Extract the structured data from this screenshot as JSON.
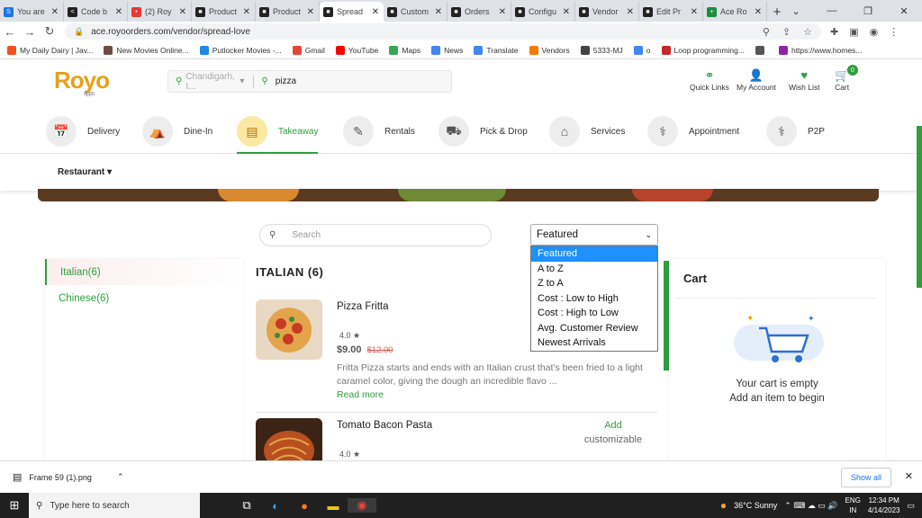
{
  "browser": {
    "tabs": [
      {
        "title": "You are",
        "icon": "S",
        "color": "#1a73e8"
      },
      {
        "title": "Code b",
        "icon": "&lt;",
        "color": "#222"
      },
      {
        "title": "(2) Roy",
        "icon": "•",
        "color": "#e53935"
      },
      {
        "title": "Product",
        "icon": "■",
        "color": "#222"
      },
      {
        "title": "Product",
        "icon": "■",
        "color": "#222"
      },
      {
        "title": "Spread",
        "icon": "■",
        "color": "#222",
        "active": true
      },
      {
        "title": "Custom",
        "icon": "■",
        "color": "#222"
      },
      {
        "title": "Orders",
        "icon": "■",
        "color": "#222"
      },
      {
        "title": "Configu",
        "icon": "■",
        "color": "#222"
      },
      {
        "title": "Vendor",
        "icon": "■",
        "color": "#222"
      },
      {
        "title": "Edit Pr",
        "icon": "■",
        "color": "#222"
      },
      {
        "title": "Ace Ro",
        "icon": "+",
        "color": "#1e8e3e"
      }
    ],
    "url": "ace.royoorders.com/vendor/spread-love",
    "bookmarks": [
      {
        "label": "My Daily Dairy | Jav...",
        "color": "#f4511e"
      },
      {
        "label": "New Movies Online...",
        "color": "#6d4c41"
      },
      {
        "label": "Putlocker Movies -...",
        "color": "#1e88e5"
      },
      {
        "label": "Gmail",
        "color": "#ea4335"
      },
      {
        "label": "YouTube",
        "color": "#ff0000"
      },
      {
        "label": "Maps",
        "color": "#34a853"
      },
      {
        "label": "News",
        "color": "#4285f4"
      },
      {
        "label": "Translate",
        "color": "#4285f4"
      },
      {
        "label": "Vendors",
        "color": "#f57c00"
      },
      {
        "label": "5333-MJ",
        "color": "#444"
      },
      {
        "label": "o",
        "color": "#4285f4"
      },
      {
        "label": "Loop programming...",
        "color": "#c62828"
      },
      {
        "label": "",
        "color": "#555"
      },
      {
        "label": "https://www.homes...",
        "color": "#8e24aa"
      }
    ]
  },
  "header": {
    "logo": "Royo",
    "logo_sub": "apps",
    "location": "Chandigarh, I...",
    "search_value": "pizza",
    "links": [
      {
        "label": "Quick Links",
        "icon": "link-icon"
      },
      {
        "label": "My Account",
        "icon": "user-icon"
      },
      {
        "label": "Wish List",
        "icon": "heart-icon"
      },
      {
        "label": "Cart",
        "icon": "cart-icon",
        "badge": "0"
      }
    ]
  },
  "categories": [
    {
      "label": "Delivery"
    },
    {
      "label": "Dine-In"
    },
    {
      "label": "Takeaway",
      "active": true
    },
    {
      "label": "Rentals"
    },
    {
      "label": "Pick & Drop"
    },
    {
      "label": "Services"
    },
    {
      "label": "Appointment"
    },
    {
      "label": "P2P"
    }
  ],
  "subnav": {
    "restaurant": "Restaurant ▾"
  },
  "search": {
    "placeholder": "Search"
  },
  "sort": {
    "selected": "Featured",
    "options": [
      "Featured",
      "A to Z",
      "Z to A",
      "Cost : Low to High",
      "Cost : High to Low",
      "Avg. Customer Review",
      "Newest Arrivals"
    ]
  },
  "sidebar": {
    "items": [
      {
        "label": "Italian(6)"
      },
      {
        "label": "Chinese(6)"
      }
    ]
  },
  "section": {
    "title": "ITALIAN (6)"
  },
  "products": [
    {
      "name": "Pizza Fritta",
      "rating": "4.0 ★",
      "price": "$9.00",
      "old_price": "$12.00",
      "desc": "Fritta Pizza starts and ends with an Italian crust that's been fried to a light caramel color, giving the dough an incredible flavo ...",
      "more": "Read more"
    },
    {
      "name": "Tomato Bacon Pasta",
      "rating": "4.0 ★",
      "add": "Add",
      "customizable": "customizable"
    }
  ],
  "cart": {
    "title": "Cart",
    "empty1": "Your cart is empty",
    "empty2": "Add an item to begin"
  },
  "download": {
    "file": "Frame 59 (1).png",
    "show_all": "Show all"
  },
  "taskbar": {
    "search": "Type here to search",
    "weather": "36°C  Sunny",
    "lang": "ENG",
    "region": "IN",
    "time": "12:34 PM",
    "date": "4/14/2023"
  }
}
